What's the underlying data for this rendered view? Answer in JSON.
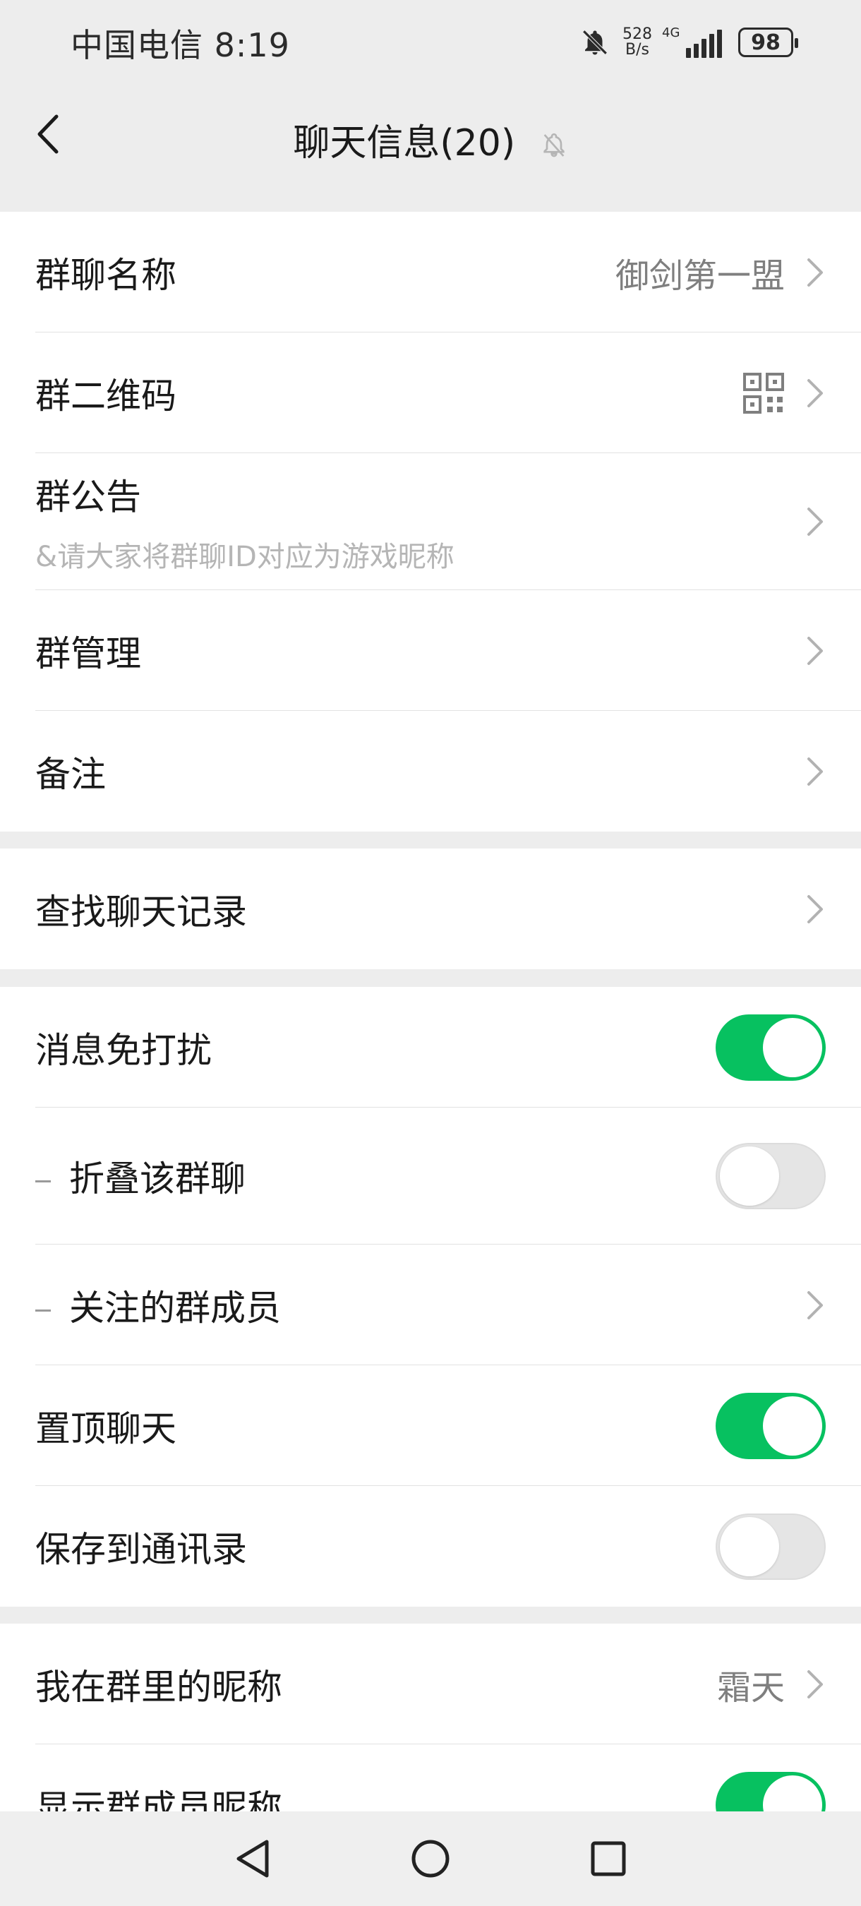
{
  "status_bar": {
    "carrier_time": "中国电信 8:19",
    "net_speed_value": "528",
    "net_speed_unit": "B/s",
    "network_type": "4G",
    "battery": "98",
    "icons": [
      "bell-off-icon",
      "signal-icon",
      "battery-icon"
    ]
  },
  "nav": {
    "title": "聊天信息(20)",
    "back_icon": "back-chevron-icon",
    "mute_icon": "bell-off-icon"
  },
  "section1": {
    "group_name_label": "群聊名称",
    "group_name_value": "御剑第一盟",
    "qr_label": "群二维码",
    "notice_label": "群公告",
    "notice_text": "&请大家将群聊ID对应为游戏昵称",
    "manage_label": "群管理",
    "remark_label": "备注"
  },
  "section2": {
    "search_label": "查找聊天记录"
  },
  "section3": {
    "dnd_label": "消息免打扰",
    "dnd_on": true,
    "fold_label": "折叠该群聊",
    "fold_on": false,
    "followed_label": "关注的群成员",
    "pin_label": "置顶聊天",
    "pin_on": true,
    "save_label": "保存到通讯录",
    "save_on": false
  },
  "section4": {
    "nickname_label": "我在群里的昵称",
    "nickname_value": "霜天",
    "show_nick_label": "显示群成员昵称",
    "show_nick_on": true
  },
  "colors": {
    "accent_green": "#07c160",
    "background": "#ededed"
  }
}
